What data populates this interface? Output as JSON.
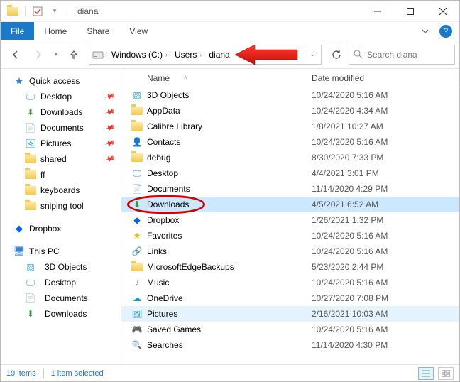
{
  "title": "diana",
  "ribbon": {
    "file": "File",
    "tabs": [
      "Home",
      "Share",
      "View"
    ]
  },
  "breadcrumb": [
    "Windows (C:)",
    "Users",
    "diana"
  ],
  "search": {
    "placeholder": "Search diana"
  },
  "columns": {
    "name": "Name",
    "date": "Date modified"
  },
  "sidebar": {
    "quick_access": {
      "label": "Quick access",
      "items": [
        {
          "label": "Desktop",
          "pinned": true,
          "icon": "desktop"
        },
        {
          "label": "Downloads",
          "pinned": true,
          "icon": "downloads"
        },
        {
          "label": "Documents",
          "pinned": true,
          "icon": "documents"
        },
        {
          "label": "Pictures",
          "pinned": true,
          "icon": "pictures"
        },
        {
          "label": "shared",
          "pinned": true,
          "icon": "folder"
        },
        {
          "label": "ff",
          "pinned": false,
          "icon": "folder"
        },
        {
          "label": "keyboards",
          "pinned": false,
          "icon": "folder"
        },
        {
          "label": "sniping tool",
          "pinned": false,
          "icon": "folder"
        }
      ]
    },
    "dropbox": {
      "label": "Dropbox"
    },
    "this_pc": {
      "label": "This PC",
      "items": [
        {
          "label": "3D Objects",
          "icon": "3d"
        },
        {
          "label": "Desktop",
          "icon": "desktop"
        },
        {
          "label": "Documents",
          "icon": "documents"
        },
        {
          "label": "Downloads",
          "icon": "downloads"
        }
      ]
    }
  },
  "files": [
    {
      "name": "3D Objects",
      "date": "10/24/2020 5:16 AM",
      "icon": "3d"
    },
    {
      "name": "AppData",
      "date": "10/24/2020 4:34 AM",
      "icon": "folder"
    },
    {
      "name": "Calibre Library",
      "date": "1/8/2021 10:27 AM",
      "icon": "folder"
    },
    {
      "name": "Contacts",
      "date": "10/24/2020 5:16 AM",
      "icon": "contacts"
    },
    {
      "name": "debug",
      "date": "8/30/2020 7:33 PM",
      "icon": "folder"
    },
    {
      "name": "Desktop",
      "date": "4/4/2021 3:01 PM",
      "icon": "desktop"
    },
    {
      "name": "Documents",
      "date": "11/14/2020 4:29 PM",
      "icon": "documents"
    },
    {
      "name": "Downloads",
      "date": "4/5/2021 6:52 AM",
      "icon": "downloads",
      "selected": true,
      "circled": true
    },
    {
      "name": "Dropbox",
      "date": "1/26/2021 1:32 PM",
      "icon": "dropbox"
    },
    {
      "name": "Favorites",
      "date": "10/24/2020 5:16 AM",
      "icon": "favorites"
    },
    {
      "name": "Links",
      "date": "10/24/2020 5:16 AM",
      "icon": "links"
    },
    {
      "name": "MicrosoftEdgeBackups",
      "date": "5/23/2020 2:44 PM",
      "icon": "folder"
    },
    {
      "name": "Music",
      "date": "10/24/2020 5:16 AM",
      "icon": "music"
    },
    {
      "name": "OneDrive",
      "date": "10/27/2020 7:08 PM",
      "icon": "onedrive"
    },
    {
      "name": "Pictures",
      "date": "2/16/2021 10:03 AM",
      "icon": "pictures",
      "highlight": true
    },
    {
      "name": "Saved Games",
      "date": "10/24/2020 5:16 AM",
      "icon": "games"
    },
    {
      "name": "Searches",
      "date": "11/14/2020 4:30 PM",
      "icon": "searches"
    }
  ],
  "status": {
    "count": "19 items",
    "selected": "1 item selected"
  }
}
